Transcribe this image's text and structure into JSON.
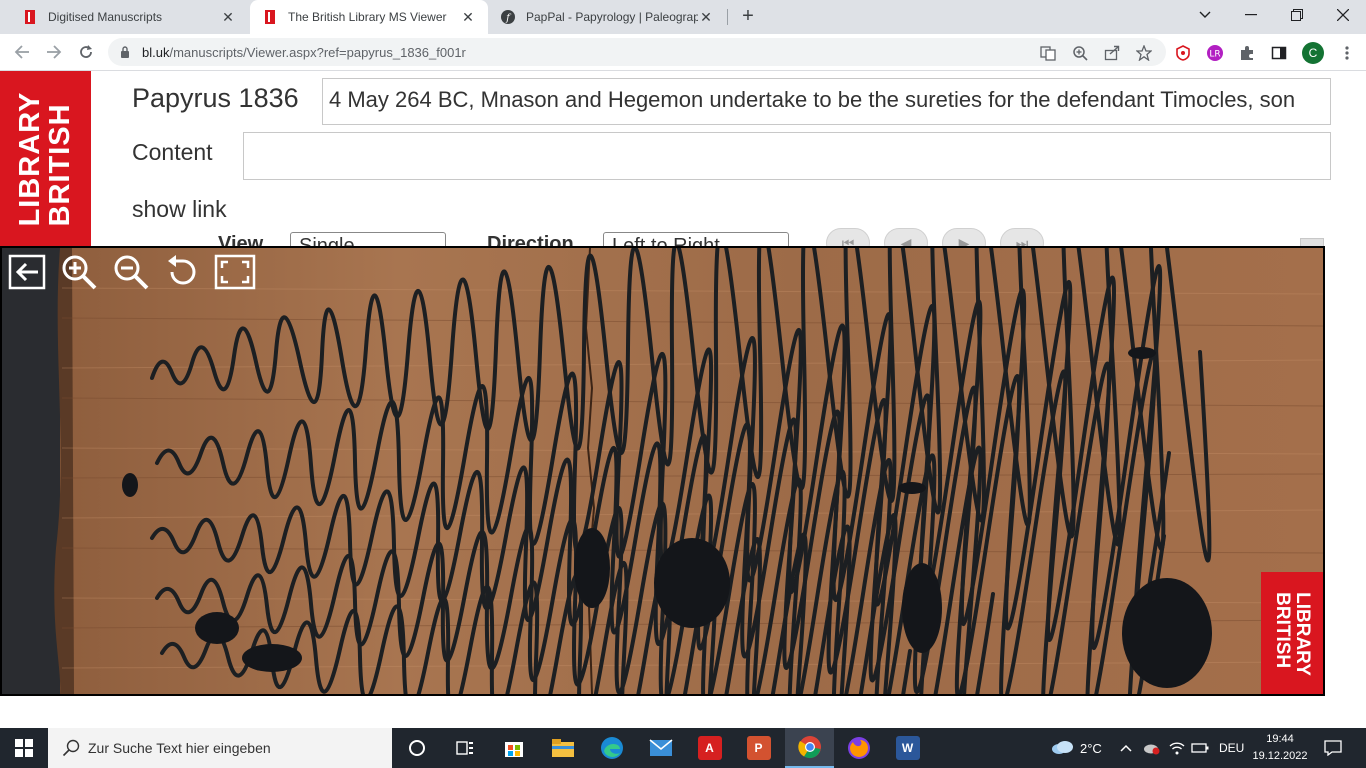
{
  "browser": {
    "tabs": [
      {
        "title": "Digitised Manuscripts",
        "active": false
      },
      {
        "title": "The British Library MS Viewer",
        "active": true
      },
      {
        "title": "PapPal - Papyrology | Paleography",
        "active": false
      }
    ],
    "url": {
      "host": "bl.uk",
      "path": "/manuscripts/Viewer.aspx?ref=papyrus_1836_f001r"
    },
    "profile_initial": "C"
  },
  "page": {
    "logo_line1": "LIBRARY",
    "logo_line2": "BRITISH",
    "manuscript_title": "Papyrus 1836",
    "description": "4 May 264 BC, Mnason and Hegemon undertake to be the sureties for the defendant Timocles, son",
    "content_label": "Content",
    "content_value": "",
    "show_link_label": "show link",
    "view_label": "View",
    "view_selected": "Single",
    "direction_label": "Direction",
    "direction_selected": "Left to Right",
    "watermark_line1": "LIBRARY",
    "watermark_line2": "BRITISH"
  },
  "taskbar": {
    "search_placeholder": "Zur Suche Text hier eingeben",
    "weather": "2°C",
    "language": "DEU",
    "time": "19:44",
    "date": "19.12.2022"
  },
  "colors": {
    "bl_red": "#d9161f",
    "papyrus": "#a06a45",
    "ink": "#1c1f22"
  }
}
